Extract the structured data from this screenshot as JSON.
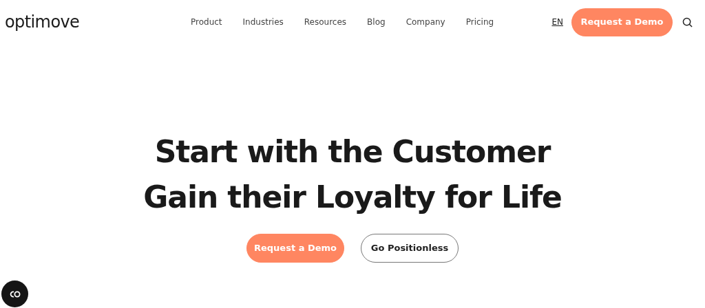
{
  "header": {
    "logo": "optimove",
    "nav": [
      "Product",
      "Industries",
      "Resources",
      "Blog",
      "Company",
      "Pricing"
    ],
    "language": "EN",
    "cta": "Request a Demo"
  },
  "hero": {
    "headline": [
      "Start with the Customer",
      "Gain their Loyalty for Life"
    ],
    "buttons": [
      {
        "label": "Request a Demo",
        "kind": "primary"
      },
      {
        "label": "Go Positionless",
        "kind": "secondary"
      }
    ]
  }
}
